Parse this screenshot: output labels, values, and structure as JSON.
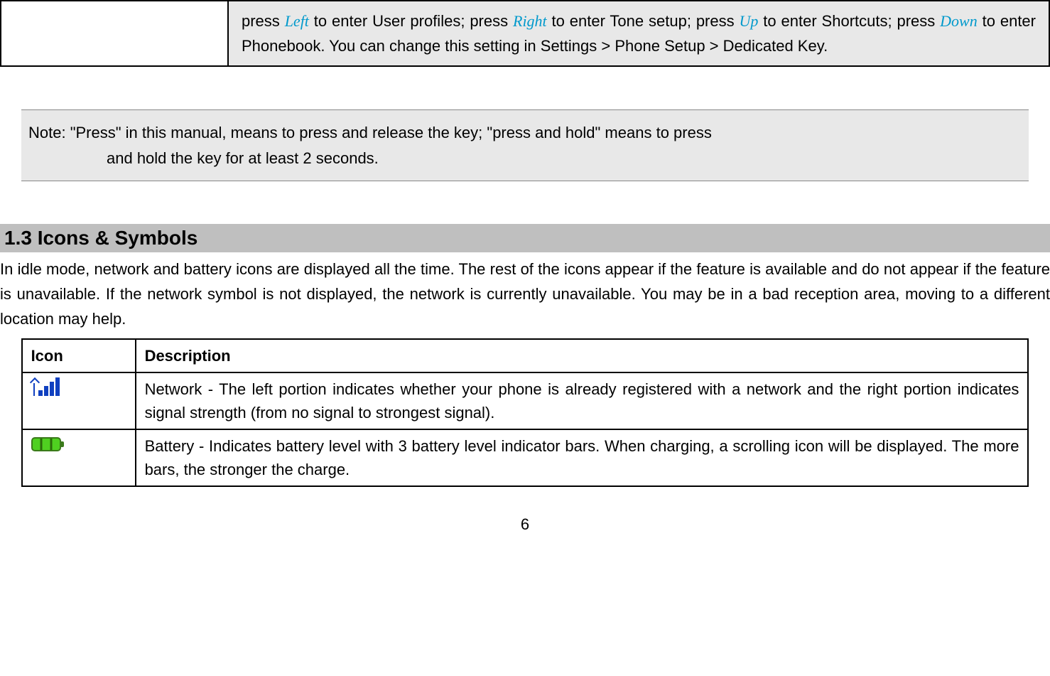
{
  "top_table": {
    "left": "",
    "text_before_left": "press ",
    "key_left": "Left",
    "text_after_left": " to enter User profiles; press ",
    "key_right": "Right",
    "text_after_right": " to enter Tone setup; press ",
    "key_up": "Up",
    "text_after_up": " to enter Shortcuts; press ",
    "key_down": "Down",
    "text_after_down": " to enter Phonebook. You can change this setting in Settings > Phone Setup > Dedicated Key."
  },
  "note": {
    "line1": "Note: \"Press\" in this manual, means to press and release the key; \"press and hold\" means to press",
    "line2": "and hold the key for at least 2 seconds."
  },
  "section": {
    "heading": "1.3  Icons & Symbols",
    "body": "In idle mode, network and battery icons are displayed all the time. The rest of the icons appear if the feature is available and do not appear if the feature is unavailable. If the network symbol is not displayed, the network is currently unavailable. You may be in a bad reception area, moving to a different location may help."
  },
  "icon_table": {
    "header_icon": "Icon",
    "header_desc": "Description",
    "rows": [
      {
        "icon_name": "signal-icon",
        "desc": "Network - The left portion indicates whether your phone is already registered with a network and the right portion indicates signal strength (from no signal to strongest signal)."
      },
      {
        "icon_name": "battery-icon",
        "desc": "Battery - Indicates battery level with 3 battery level indicator bars. When charging, a scrolling icon will be displayed. The more bars, the stronger the charge."
      }
    ]
  },
  "page_number": "6"
}
